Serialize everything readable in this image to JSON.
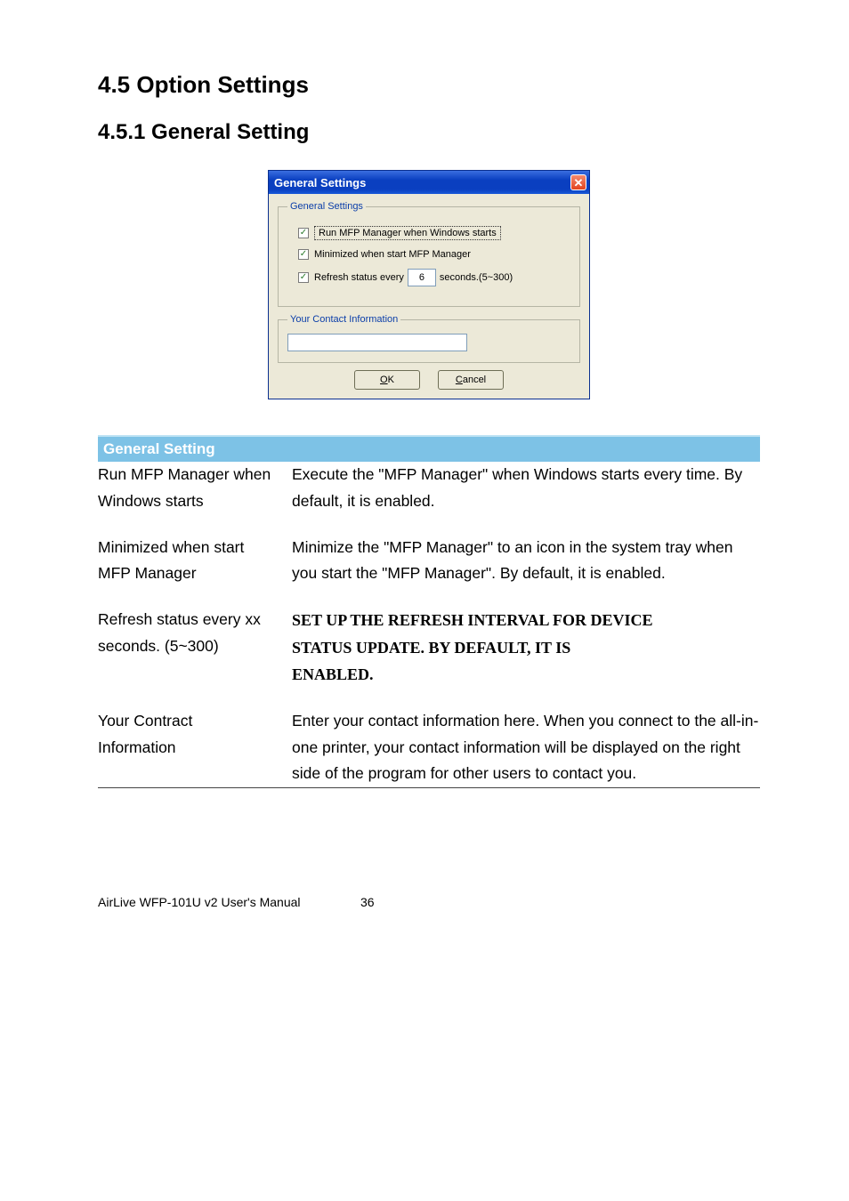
{
  "headings": {
    "h1": "4.5   Option Settings",
    "h2": "4.5.1   General Setting"
  },
  "dialog": {
    "title": "General Settings",
    "group1_legend": "General Settings",
    "opt_run": "Run MFP Manager when Windows starts",
    "opt_min": "Minimized when start MFP Manager",
    "opt_refresh_prefix": "Refresh status every",
    "opt_refresh_value": "6",
    "opt_refresh_suffix": "seconds.(5~300)",
    "group2_legend": "Your Contact Information",
    "btn_ok_u": "O",
    "btn_ok_rest": "K",
    "btn_cancel_u": "C",
    "btn_cancel_rest": "ancel"
  },
  "section_bar": "General Setting",
  "rows": {
    "r1": {
      "left_l1": "Run MFP Manager when",
      "left_l2": "Windows starts",
      "right": "Execute the \"MFP Manager\" when Windows starts every time. By default, it is enabled."
    },
    "r2": {
      "left_l1": "Minimized when start",
      "left_l2": "MFP Manager",
      "right": "Minimize the \"MFP Manager\" to an icon in the system tray when you start the \"MFP Manager\". By default, it is enabled."
    },
    "r3": {
      "left_l1": "Refresh status every xx",
      "left_l2": "seconds. (5~300)",
      "right_l1": "SET UP THE REFRESH INTERVAL FOR DEVICE",
      "right_l2": "STATUS UPDATE. BY DEFAULT, IT IS",
      "right_l3": "ENABLED."
    },
    "r4": {
      "left_l1": "Your Contract",
      "left_l2": "Information",
      "right": "Enter your contact information here. When you connect to the all-in-one printer, your contact information will be displayed on the right side of the program for other users to contact you."
    }
  },
  "footer": {
    "text": "AirLive WFP-101U v2 User's Manual",
    "page": "36"
  }
}
